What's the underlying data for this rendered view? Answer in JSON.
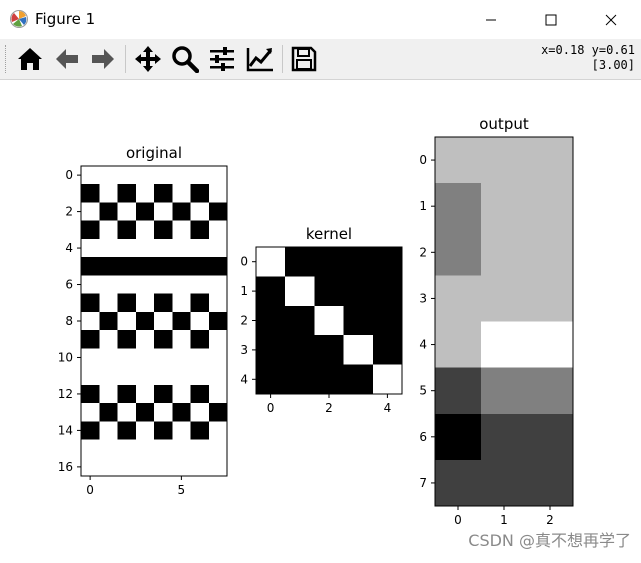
{
  "window": {
    "title": "Figure 1"
  },
  "titlebar": {
    "app_icon": "matplotlib-icon",
    "buttons": [
      {
        "name": "minimize-button",
        "icon": "minimize-icon"
      },
      {
        "name": "maximize-button",
        "icon": "maximize-icon"
      },
      {
        "name": "close-button",
        "icon": "close-icon"
      }
    ]
  },
  "toolbar": {
    "buttons": [
      {
        "name": "home-button",
        "icon": "home-icon"
      },
      {
        "name": "back-button",
        "icon": "back-arrow-icon"
      },
      {
        "name": "forward-button",
        "icon": "forward-arrow-icon"
      },
      {
        "name": "pan-button",
        "icon": "pan-icon"
      },
      {
        "name": "zoom-button",
        "icon": "zoom-icon"
      },
      {
        "name": "subplots-button",
        "icon": "subplots-config-icon"
      },
      {
        "name": "edit-axis-button",
        "icon": "edit-curve-icon"
      },
      {
        "name": "save-button",
        "icon": "save-icon"
      }
    ],
    "coords_line1": "x=0.18 y=0.61",
    "coords_line2": "[3.00]"
  },
  "watermark": "CSDN @真不想再学了",
  "chart_data": [
    {
      "type": "heatmap",
      "title": "original",
      "colormap": "gray",
      "rows": 17,
      "cols": 8,
      "matrix": [
        [
          1,
          1,
          1,
          1,
          1,
          1,
          1,
          1
        ],
        [
          0,
          1,
          0,
          1,
          0,
          1,
          0,
          1
        ],
        [
          1,
          0,
          1,
          0,
          1,
          0,
          1,
          0
        ],
        [
          0,
          1,
          0,
          1,
          0,
          1,
          0,
          1
        ],
        [
          1,
          1,
          1,
          1,
          1,
          1,
          1,
          1
        ],
        [
          0,
          0,
          0,
          0,
          0,
          0,
          0,
          0
        ],
        [
          1,
          1,
          1,
          1,
          1,
          1,
          1,
          1
        ],
        [
          0,
          1,
          0,
          1,
          0,
          1,
          0,
          1
        ],
        [
          1,
          0,
          1,
          0,
          1,
          0,
          1,
          0
        ],
        [
          0,
          1,
          0,
          1,
          0,
          1,
          0,
          1
        ],
        [
          1,
          1,
          1,
          1,
          1,
          1,
          1,
          1
        ],
        [
          1,
          1,
          1,
          1,
          1,
          1,
          1,
          1
        ],
        [
          0,
          1,
          0,
          1,
          0,
          1,
          0,
          1
        ],
        [
          1,
          0,
          1,
          0,
          1,
          0,
          1,
          0
        ],
        [
          0,
          1,
          0,
          1,
          0,
          1,
          0,
          1
        ],
        [
          1,
          1,
          1,
          1,
          1,
          1,
          1,
          1
        ],
        [
          1,
          1,
          1,
          1,
          1,
          1,
          1,
          1
        ]
      ],
      "xticks": [
        0,
        5
      ],
      "yticks": [
        0,
        2,
        4,
        6,
        8,
        10,
        12,
        14,
        16
      ]
    },
    {
      "type": "heatmap",
      "title": "kernel",
      "colormap": "gray",
      "rows": 5,
      "cols": 5,
      "matrix": [
        [
          1,
          0,
          0,
          0,
          0
        ],
        [
          0,
          1,
          0,
          0,
          0
        ],
        [
          0,
          0,
          1,
          0,
          0
        ],
        [
          0,
          0,
          0,
          1,
          0
        ],
        [
          0,
          0,
          0,
          0,
          1
        ]
      ],
      "xticks": [
        0,
        2,
        4
      ],
      "yticks": [
        0,
        1,
        2,
        3,
        4
      ]
    },
    {
      "type": "heatmap",
      "title": "output",
      "colormap": "gray",
      "rows": 8,
      "cols": 3,
      "matrix": [
        [
          0.75,
          0.75,
          0.75
        ],
        [
          0.5,
          0.75,
          0.75
        ],
        [
          0.5,
          0.75,
          0.75
        ],
        [
          0.75,
          0.75,
          0.75
        ],
        [
          0.75,
          1.0,
          1.0
        ],
        [
          0.25,
          0.5,
          0.5
        ],
        [
          0.0,
          0.25,
          0.25
        ],
        [
          0.25,
          0.25,
          0.25
        ]
      ],
      "xticks": [
        0,
        1,
        2
      ],
      "yticks": [
        0,
        1,
        2,
        3,
        4,
        5,
        6,
        7
      ]
    }
  ]
}
